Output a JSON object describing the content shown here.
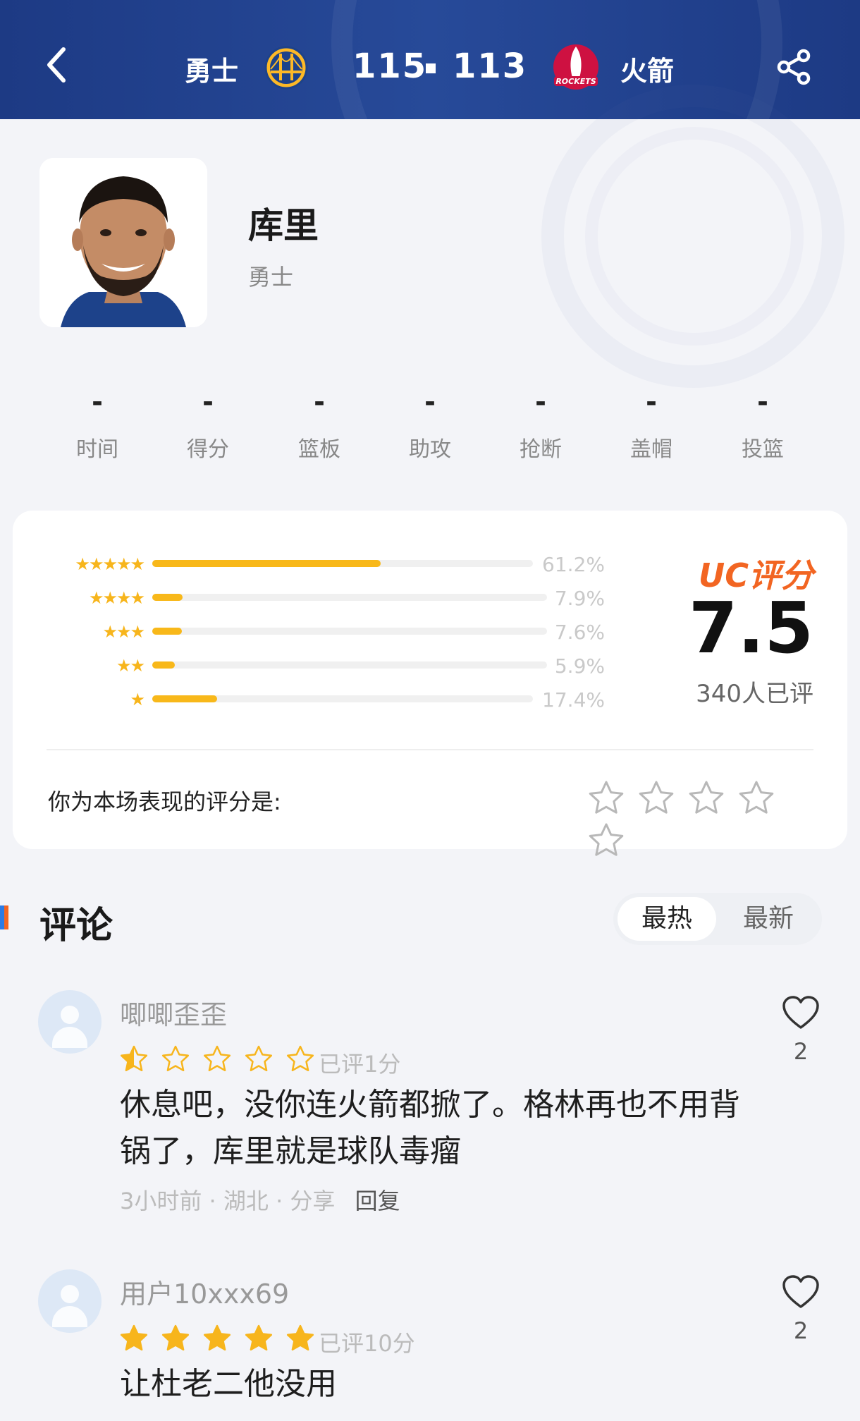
{
  "header": {
    "home_team": "勇士",
    "away_team": "火箭",
    "home_score": "115",
    "away_score": "113",
    "away_logo_text": "ROCKETS",
    "colors": {
      "bar": "#1d3a84",
      "text": "#ffffff"
    }
  },
  "player": {
    "name": "库里",
    "team": "勇士"
  },
  "stats": [
    {
      "label": "时间",
      "value": "-"
    },
    {
      "label": "得分",
      "value": "-"
    },
    {
      "label": "篮板",
      "value": "-"
    },
    {
      "label": "助攻",
      "value": "-"
    },
    {
      "label": "抢断",
      "value": "-"
    },
    {
      "label": "盖帽",
      "value": "-"
    },
    {
      "label": "投篮",
      "value": "-"
    }
  ],
  "rating": {
    "distribution": [
      {
        "stars": 5,
        "percent": "61.2%",
        "fraction": 0.612
      },
      {
        "stars": 4,
        "percent": "7.9%",
        "fraction": 0.079
      },
      {
        "stars": 3,
        "percent": "7.6%",
        "fraction": 0.076
      },
      {
        "stars": 2,
        "percent": "5.9%",
        "fraction": 0.059
      },
      {
        "stars": 1,
        "percent": "17.4%",
        "fraction": 0.174
      }
    ],
    "uc_label": "UC评分",
    "score": "7.5",
    "count_text": "340人已评",
    "your_rating_label": "你为本场表现的评分是:",
    "colors": {
      "bar": "#f8b81a",
      "uc": "#f26522"
    }
  },
  "comments_section": {
    "title": "评论",
    "tabs": [
      {
        "label": "最热",
        "active": true
      },
      {
        "label": "最新",
        "active": false
      }
    ]
  },
  "comments": [
    {
      "user": "唧唧歪歪",
      "stars": 0.5,
      "given": "已评1分",
      "text": "休息吧，没你连火箭都掀了。格林再也不用背锅了，库里就是球队毒瘤",
      "time": "3小时前",
      "location": "湖北",
      "share": "分享",
      "reply": "回复",
      "likes": "2"
    },
    {
      "user": "用户10xxx69",
      "stars": 5,
      "given": "已评10分",
      "text": "让杜老二他没用",
      "likes": "2"
    }
  ]
}
